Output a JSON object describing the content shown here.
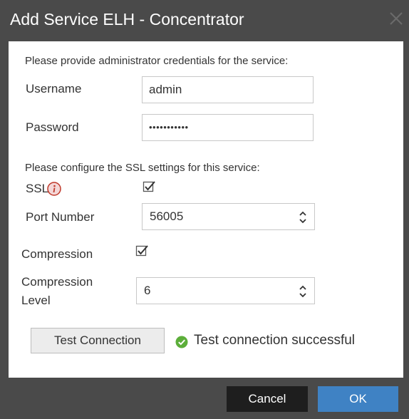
{
  "dialog": {
    "title": "Add Service ELH - Concentrator",
    "close_icon": "close-icon"
  },
  "credentials": {
    "instruction": "Please provide administrator credentials for the service:",
    "username_label": "Username",
    "username_value": "admin",
    "password_label": "Password",
    "password_masked": "•••••••••••"
  },
  "ssl": {
    "instruction": "Please configure the SSL settings for this service:",
    "ssl_label": "SSL",
    "ssl_info_icon": "info-icon",
    "ssl_checked": true,
    "port_label": "Port Number",
    "port_value": "56005"
  },
  "compression": {
    "label": "Compression",
    "checked": true,
    "level_label_line1": "Compression",
    "level_label_line2": "Level",
    "level_value": "6"
  },
  "test": {
    "button_label": "Test Connection",
    "status_icon": "check-circle-icon",
    "status_text": "Test connection successful"
  },
  "footer": {
    "cancel_label": "Cancel",
    "ok_label": "OK"
  },
  "colors": {
    "title_bar": "#4a4a4a",
    "ok_button": "#3f82c4",
    "cancel_button": "#1e1e1e",
    "success": "#5cae3a",
    "info": "#c0392b"
  }
}
